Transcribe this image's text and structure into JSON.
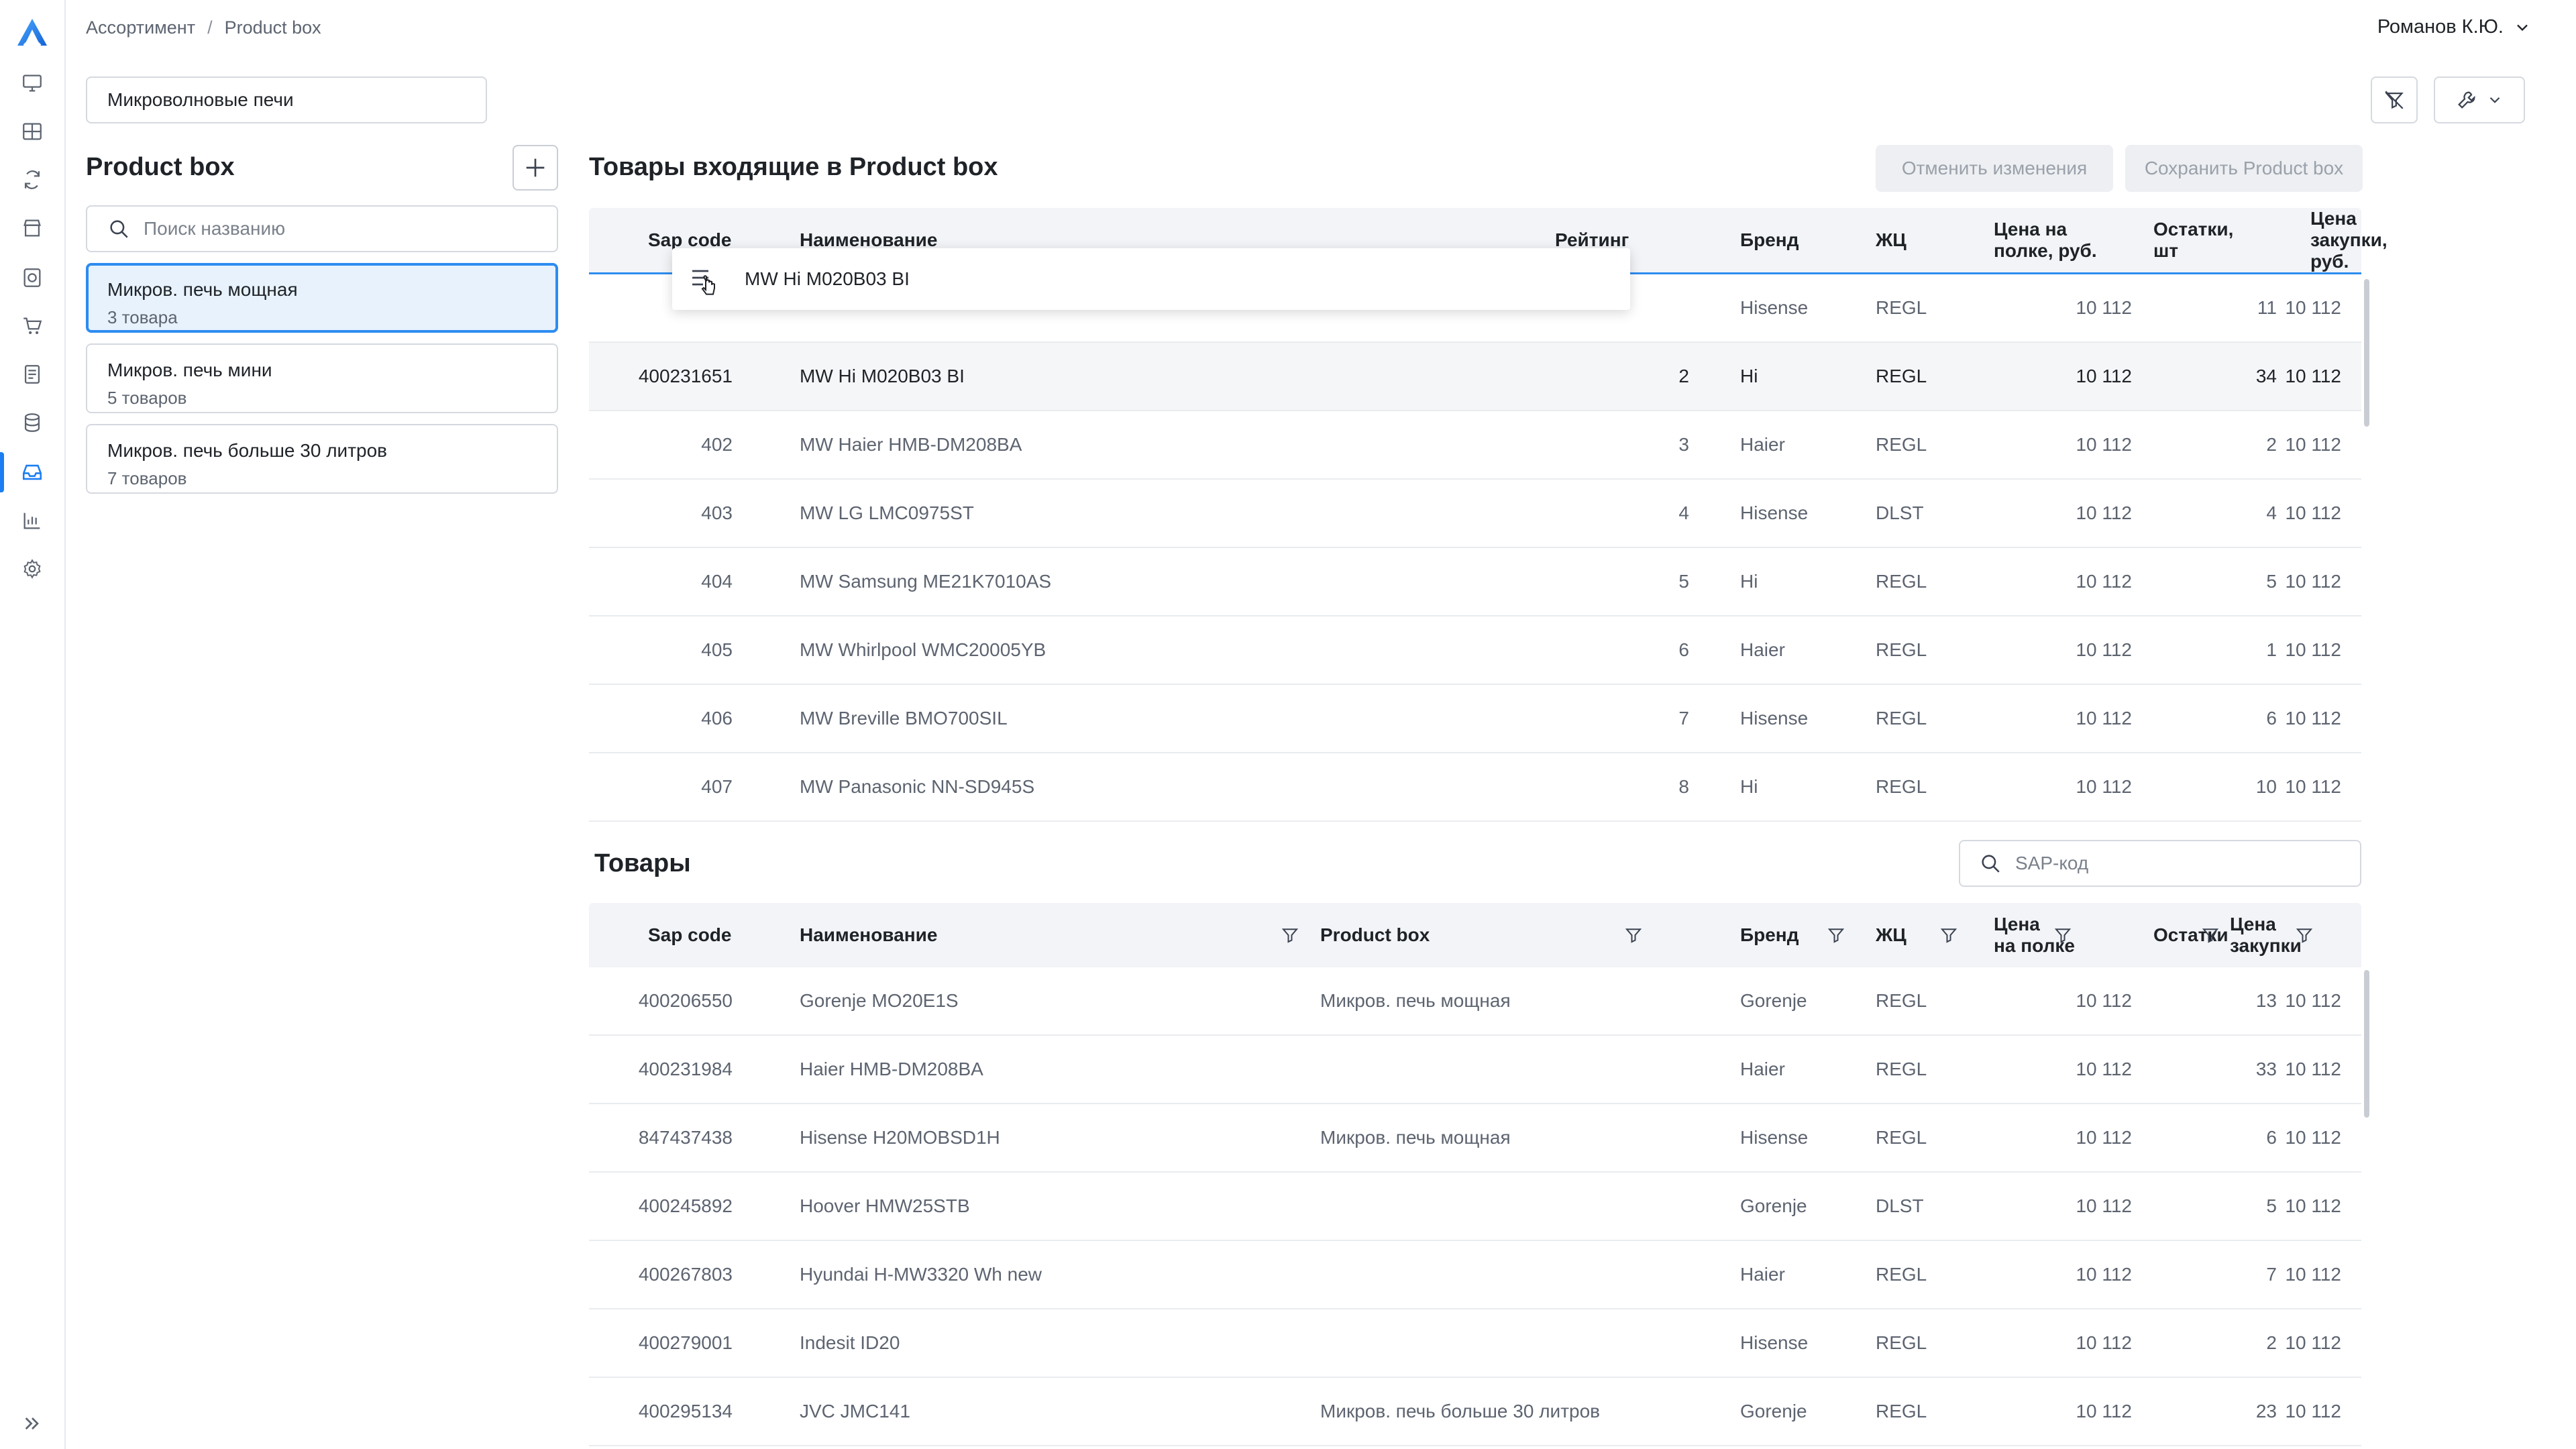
{
  "header": {
    "breadcrumb": [
      "Ассортимент",
      "Product box"
    ],
    "breadcrumb_sep": "/",
    "user_name": "Романов К.Ю.",
    "category_value": "Микроволновые печи"
  },
  "nav_icons": [
    "monitor-icon",
    "grid-icon",
    "refresh-icon",
    "store-icon",
    "coins-icon",
    "cart-icon",
    "document-icon",
    "database-icon",
    "inbox-icon",
    "chart-icon",
    "settings-icon"
  ],
  "left_panel": {
    "title": "Product box",
    "search_placeholder": "Поиск названию",
    "items": [
      {
        "name": "Микров. печь мощная",
        "count": "3 товара"
      },
      {
        "name": "Микров. печь мини",
        "count": "5 товаров"
      },
      {
        "name": "Микров. печь больше 30 литров",
        "count": "7 товаров"
      }
    ]
  },
  "incoming": {
    "title": "Товары входящие в Product box",
    "cancel_label": "Отменить изменения",
    "save_label": "Сохранить Product box",
    "columns": [
      "Sap code",
      "Наименование",
      "Рейтинг",
      "Бренд",
      "ЖЦ",
      "Цена на\nполке, руб.",
      "Остатки,\nшт",
      "Цена\nзакупки, руб."
    ],
    "drag_ghost": "MW Hi M020B03 BI",
    "rows": [
      [
        "",
        "",
        "",
        "Hisense",
        "REGL",
        "10 112",
        "11",
        "10 112"
      ],
      [
        "400231651",
        "MW Hi M020B03 BI",
        "2",
        "Hi",
        "REGL",
        "10 112",
        "34",
        "10 112"
      ],
      [
        "402",
        "MW Haier HMB-DM208BA",
        "3",
        "Haier",
        "REGL",
        "10 112",
        "2",
        "10 112"
      ],
      [
        "403",
        "MW LG LMC0975ST",
        "4",
        "Hisense",
        "DLST",
        "10 112",
        "4",
        "10 112"
      ],
      [
        "404",
        "MW Samsung ME21K7010AS",
        "5",
        "Hi",
        "REGL",
        "10 112",
        "5",
        "10 112"
      ],
      [
        "405",
        "MW Whirlpool WMC20005YB",
        "6",
        "Haier",
        "REGL",
        "10 112",
        "1",
        "10 112"
      ],
      [
        "406",
        "MW Breville BMO700SIL",
        "7",
        "Hisense",
        "REGL",
        "10 112",
        "6",
        "10 112"
      ],
      [
        "407",
        "MW Panasonic NN-SD945S",
        "8",
        "Hi",
        "REGL",
        "10 112",
        "10",
        "10 112"
      ]
    ]
  },
  "products": {
    "title": "Товары",
    "search_placeholder": "SAP-код",
    "columns": [
      "Sap code",
      "Наименование",
      "Product box",
      "Бренд",
      "ЖЦ",
      "Цена\nна полке",
      "Остатки",
      "Цена\nзакупки"
    ],
    "rows": [
      [
        "400206550",
        "Gorenje MO20E1S",
        "Микров. печь мощная",
        "Gorenje",
        "REGL",
        "10 112",
        "13",
        "10 112"
      ],
      [
        "400231984",
        "Haier HMB-DM208BA",
        "",
        "Haier",
        "REGL",
        "10 112",
        "33",
        "10 112"
      ],
      [
        "847437438",
        "Hisense H20MOBSD1H",
        "Микров. печь мощная",
        "Hisense",
        "REGL",
        "10 112",
        "6",
        "10 112"
      ],
      [
        "400245892",
        "Hoover HMW25STB",
        "",
        "Gorenje",
        "DLST",
        "10 112",
        "5",
        "10 112"
      ],
      [
        "400267803",
        "Hyundai H-MW3320 Wh new",
        "",
        "Haier",
        "REGL",
        "10 112",
        "7",
        "10 112"
      ],
      [
        "400279001",
        "Indesit ID20",
        "",
        "Hisense",
        "REGL",
        "10 112",
        "2",
        "10 112"
      ],
      [
        "400295134",
        "JVC JMC141",
        "Микров. печь больше 30 литров",
        "Gorenje",
        "REGL",
        "10 112",
        "23",
        "10 112"
      ]
    ]
  },
  "colors": {
    "accent": "#2d8cf0",
    "selected_bg": "#e7f2fd",
    "header_bg": "#f2f4f7"
  }
}
